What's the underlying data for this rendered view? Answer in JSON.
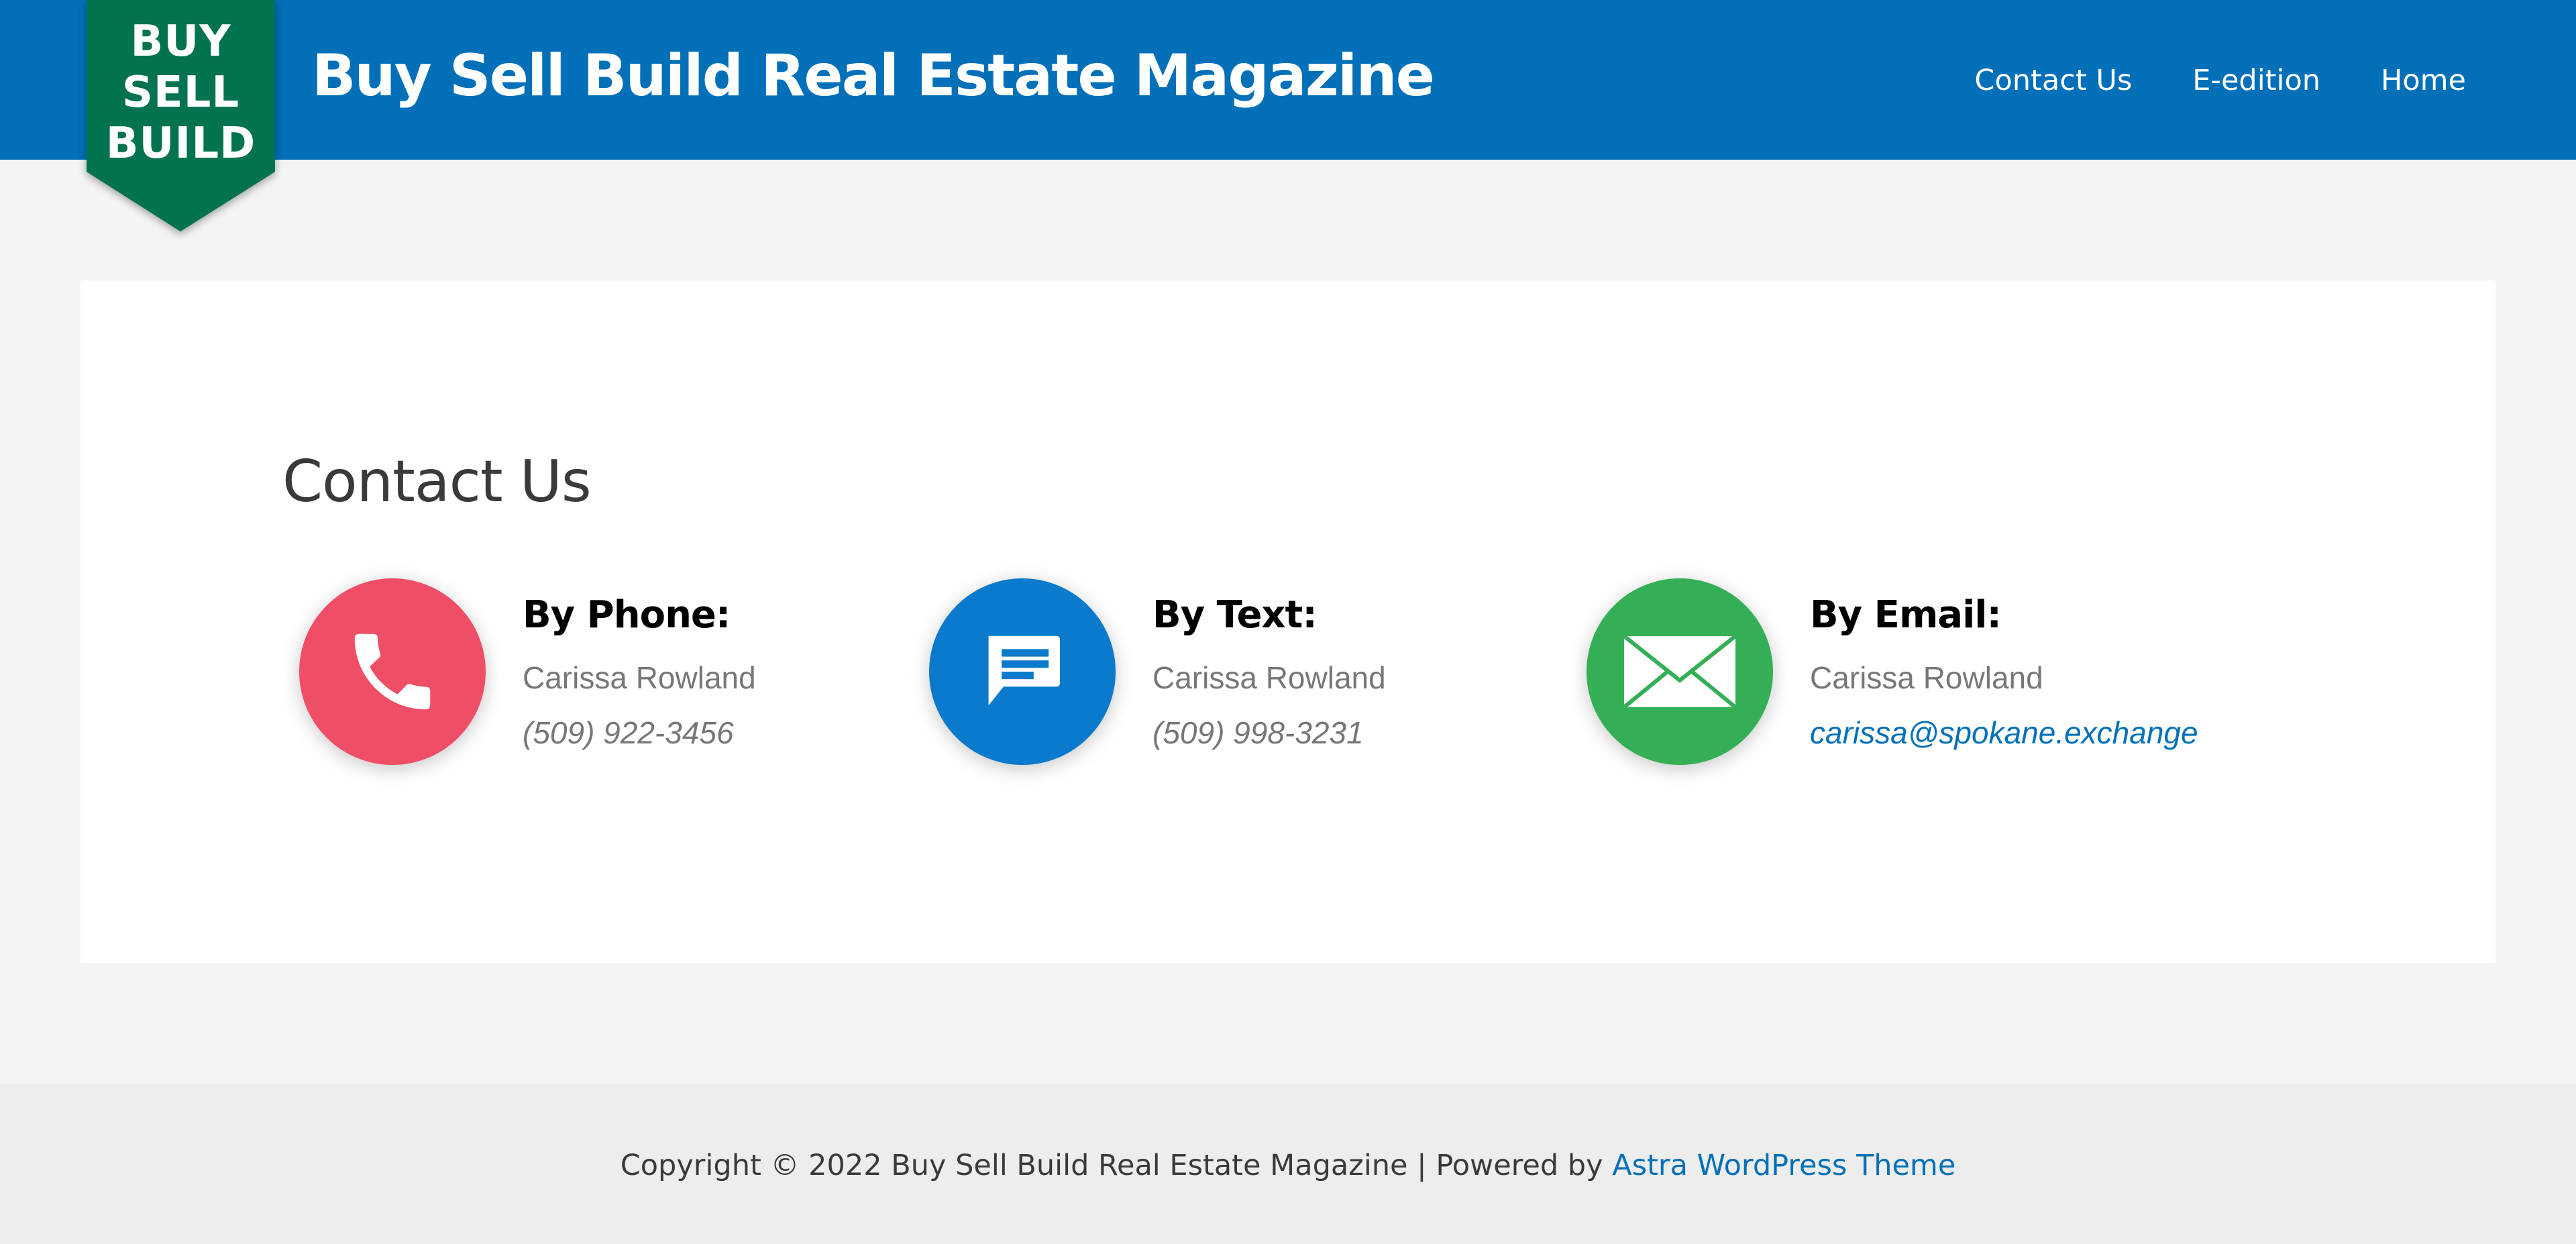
{
  "header": {
    "logo_lines": [
      "BUY",
      "SELL",
      "BUILD"
    ],
    "site_title": "Buy Sell Build Real Estate Magazine",
    "nav": [
      {
        "label": "Contact Us"
      },
      {
        "label": "E-edition"
      },
      {
        "label": "Home"
      }
    ]
  },
  "main": {
    "page_title": "Contact Us",
    "contacts": [
      {
        "icon": "phone-icon",
        "title": "By Phone:",
        "name": "Carissa Rowland",
        "value": "(509) 922-3456",
        "color": "#F04E67"
      },
      {
        "icon": "message-icon",
        "title": "By Text:",
        "name": "Carissa Rowland",
        "value": "(509) 998-3231",
        "color": "#0A7ACC"
      },
      {
        "icon": "mail-icon",
        "title": "By Email:",
        "name": "Carissa Rowland",
        "value": "carissa@spokane.exchange",
        "color": "#34AF55"
      }
    ]
  },
  "footer": {
    "copyright": "Copyright © 2022 Buy Sell Build Real Estate Magazine | Powered by ",
    "theme_link": "Astra WordPress Theme"
  },
  "colors": {
    "header_bg": "#0170B9",
    "logo_green": "#037250",
    "page_bg": "#F4F4F4",
    "footer_bg": "#EDEDED",
    "link": "#0170B9"
  }
}
